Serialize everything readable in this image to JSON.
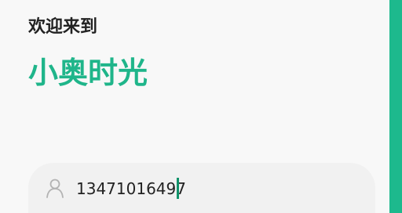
{
  "welcome_text": "欢迎来到",
  "brand_title": "小奥时光",
  "phone_input": {
    "value": "13471016497",
    "icon": "user-icon"
  },
  "colors": {
    "accent": "#1fb58a",
    "right_bar": "#1db98d",
    "field_background": "#f1f1f1",
    "caret": "#12936b"
  }
}
